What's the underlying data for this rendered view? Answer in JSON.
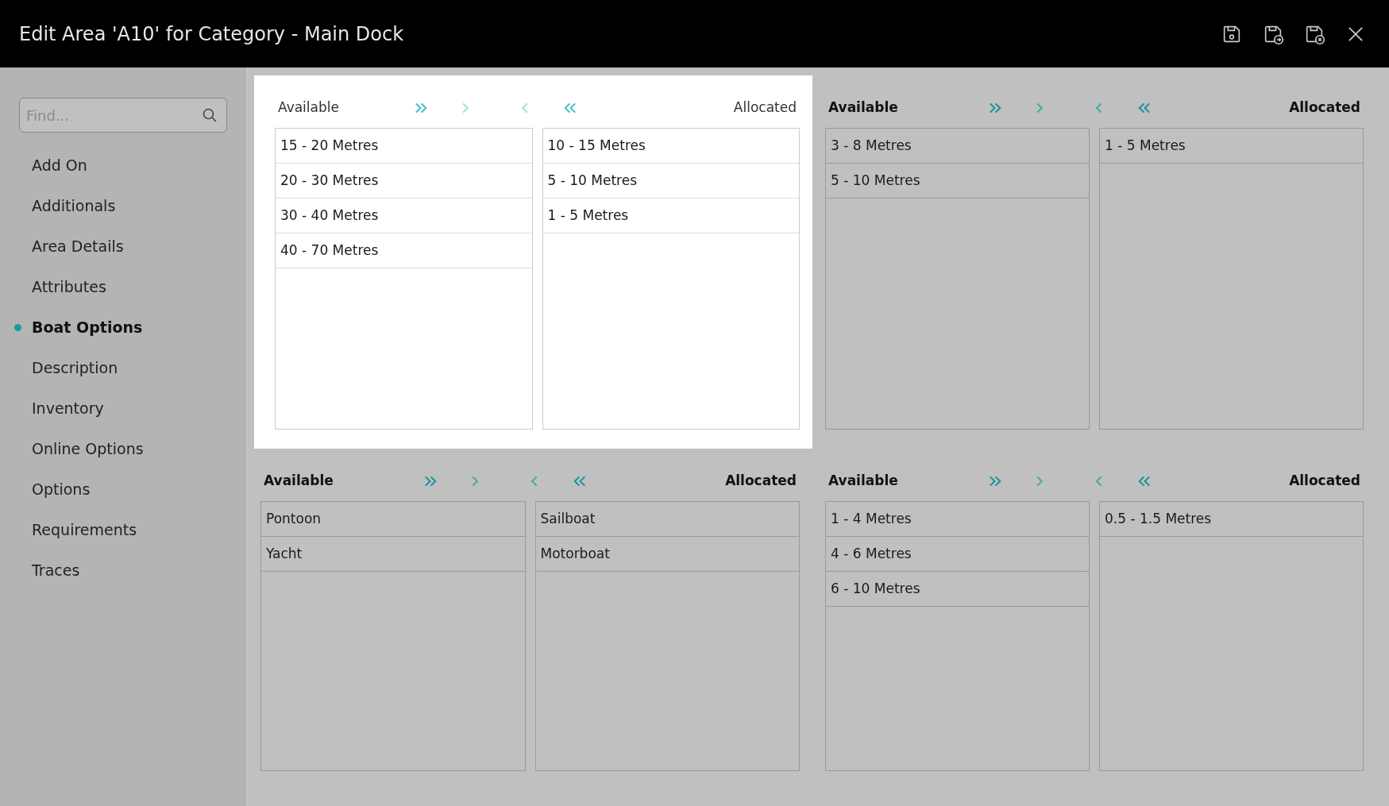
{
  "window": {
    "title": "Edit Area 'A10' for Category - Main Dock"
  },
  "header_buttons": [
    {
      "kind": "save"
    },
    {
      "kind": "save-next"
    },
    {
      "kind": "save-close"
    },
    {
      "kind": "close"
    }
  ],
  "sidebar": {
    "search": {
      "placeholder": "Find..."
    },
    "items": [
      {
        "label": "Add On",
        "selected": false
      },
      {
        "label": "Additionals",
        "selected": false
      },
      {
        "label": "Area Details",
        "selected": false
      },
      {
        "label": "Attributes",
        "selected": false
      },
      {
        "label": "Boat Options",
        "selected": true
      },
      {
        "label": "Description",
        "selected": false
      },
      {
        "label": "Inventory",
        "selected": false
      },
      {
        "label": "Online Options",
        "selected": false
      },
      {
        "label": "Options",
        "selected": false
      },
      {
        "label": "Requirements",
        "selected": false
      },
      {
        "label": "Traces",
        "selected": false
      }
    ]
  },
  "panels": [
    {
      "highlighted": true,
      "available_label": "Available",
      "allocated_label": "Allocated",
      "available": [
        "15 - 20 Metres",
        "20 - 30 Metres",
        "30 - 40 Metres",
        "40 - 70 Metres"
      ],
      "allocated": [
        "10 - 15 Metres",
        "5 - 10 Metres",
        "1 - 5 Metres"
      ]
    },
    {
      "highlighted": false,
      "available_label": "Available",
      "allocated_label": "Allocated",
      "available": [
        "3 - 8 Metres",
        "5 - 10 Metres"
      ],
      "allocated": [
        "1 - 5 Metres"
      ]
    },
    {
      "highlighted": false,
      "available_label": "Available",
      "allocated_label": "Allocated",
      "available": [
        "Pontoon",
        "Yacht"
      ],
      "allocated": [
        "Sailboat",
        "Motorboat"
      ]
    },
    {
      "highlighted": false,
      "available_label": "Available",
      "allocated_label": "Allocated",
      "available": [
        "1 - 4 Metres",
        "4 - 6 Metres",
        "6 - 10 Metres"
      ],
      "allocated": [
        "0.5 - 1.5 Metres"
      ]
    }
  ]
}
